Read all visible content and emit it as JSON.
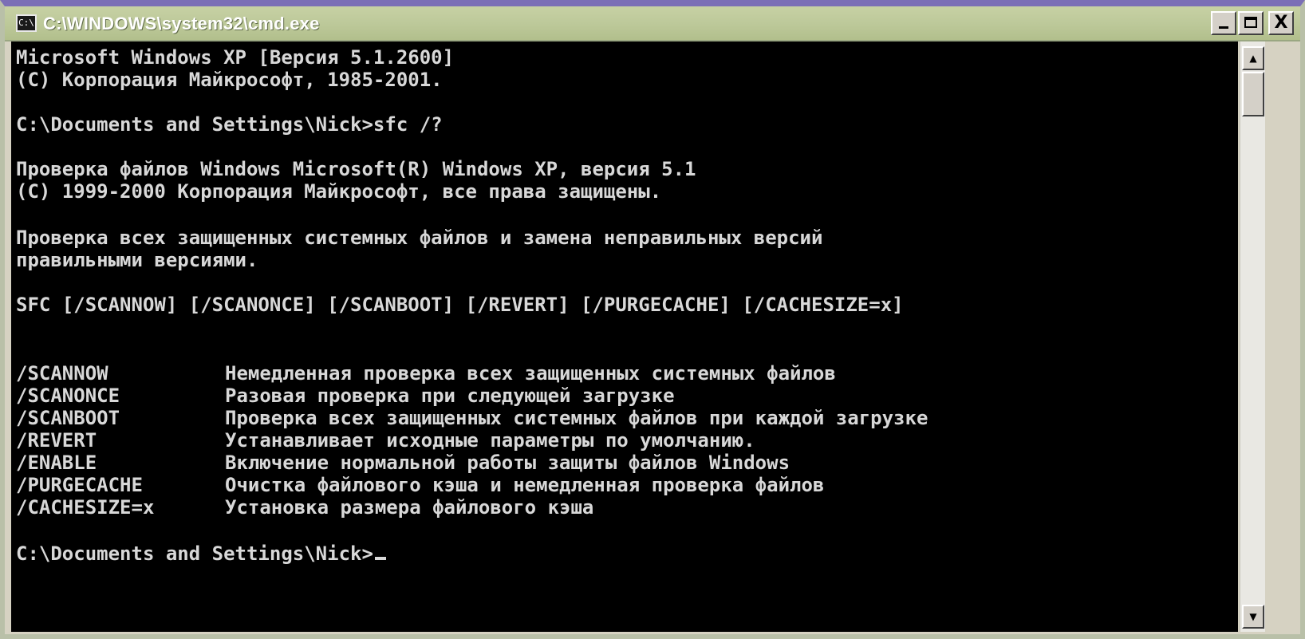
{
  "window": {
    "title": "C:\\WINDOWS\\system32\\cmd.exe",
    "icon": "cmd-icon",
    "icon_label": "C:\\",
    "controls": {
      "minimize_icon": "minimize-icon",
      "maximize_icon": "maximize-icon",
      "close_icon": "close-icon",
      "close_glyph": "X"
    }
  },
  "console": {
    "lines": [
      "Microsoft Windows XP [Версия 5.1.2600]",
      "(C) Корпорация Майкрософт, 1985-2001.",
      "",
      "C:\\Documents and Settings\\Nick>sfc /?",
      "",
      "Проверка файлов Windows Microsoft(R) Windows XP, версия 5.1",
      "(C) 1999-2000 Корпорация Майкрософт, все права защищены.",
      "",
      "Проверка всех защищенных системных файлов и замена неправильных версий",
      "правильными версиями.",
      "",
      "SFC [/SCANNOW] [/SCANONCE] [/SCANBOOT] [/REVERT] [/PURGECACHE] [/CACHESIZE=x]"
    ],
    "options": [
      {
        "name": "/SCANNOW",
        "description": "Немедленная проверка всех защищенных системных файлов"
      },
      {
        "name": "/SCANONCE",
        "description": "Разовая проверка при следующей загрузке"
      },
      {
        "name": "/SCANBOOT",
        "description": "Проверка всех защищенных системных файлов при каждой загрузке"
      },
      {
        "name": "/REVERT",
        "description": "Устанавливает исходные параметры по умолчанию."
      },
      {
        "name": "/ENABLE",
        "description": "Включение нормальной работы защиты файлов Windows"
      },
      {
        "name": "/PURGECACHE",
        "description": "Очистка файлового кэша и немедленная проверка файлов"
      },
      {
        "name": "/CACHESIZE=x",
        "description": "Установка размера файлового кэша"
      }
    ],
    "prompt": "C:\\Documents and Settings\\Nick>"
  },
  "scrollbar": {
    "up_icon": "scroll-up-arrow-icon",
    "down_icon": "scroll-down-arrow-icon",
    "up_glyph": "▲",
    "down_glyph": "▼"
  },
  "colors": {
    "console_background": "#000000",
    "console_text": "#d8d8d8",
    "titlebar": "#bdc99a"
  }
}
